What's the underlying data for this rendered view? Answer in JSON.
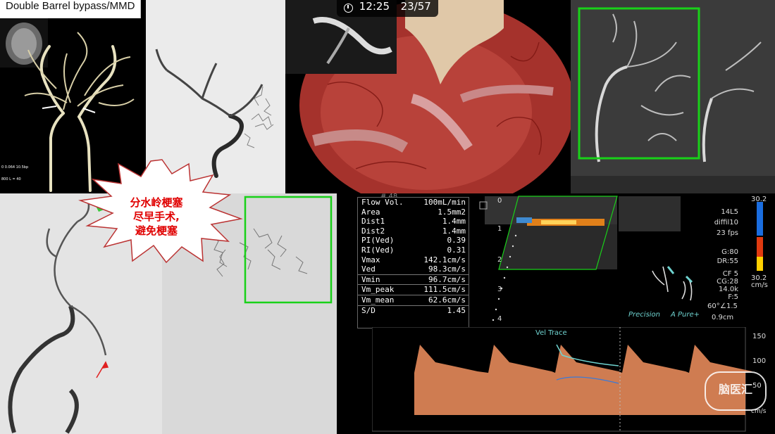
{
  "title": "Double Barrel bypass/MMD",
  "video": {
    "time": "12:25",
    "page": "23/57"
  },
  "callout": {
    "line1": "分水岭梗塞",
    "line2": "尽早手术,",
    "line3": "避免梗塞"
  },
  "mra_overlay": {
    "line1": "0 0.064 10.5bp",
    "line2": "800 L = 40"
  },
  "flow_measurements": [
    {
      "label": "Flow Vol.",
      "value": "100mL/min"
    },
    {
      "label": "Area",
      "value": "1.5mm2"
    },
    {
      "label": "Dist1",
      "value": "1.4mm"
    },
    {
      "label": "Dist2",
      "value": "1.4mm"
    },
    {
      "label": "PI(Ved)",
      "value": "0.39"
    },
    {
      "label": "RI(Ved)",
      "value": "0.31"
    },
    {
      "label": "Vmax",
      "value": "142.1cm/s"
    },
    {
      "label": "Ved",
      "value": "98.3cm/s"
    },
    {
      "label": "Vmin",
      "value": "96.7cm/s"
    },
    {
      "label": "Vm_peak",
      "value": "111.5cm/s"
    },
    {
      "label": "Vm_mean",
      "value": "62.6cm/s"
    },
    {
      "label": "S/D",
      "value": "1.45"
    }
  ],
  "ultrasound": {
    "frame_no": "# 48",
    "probe": "14L5",
    "mode": "diffil10",
    "fps": "23 fps",
    "gain": "G:80",
    "dr": "DR:55",
    "cf": "CF 5",
    "cg": "CG:28",
    "prf": "14.0k",
    "f": "F:5",
    "angle": "60°",
    "angle_corr": "∠1.5",
    "depth": "0.9cm",
    "scale_top": "30.2",
    "scale_bottom": "30.2",
    "scale_unit": "cm/s",
    "depth_ticks": [
      "0",
      "1",
      "2",
      "3",
      "4"
    ],
    "brand_precision": "Precision",
    "brand_apure": "A Pure+"
  },
  "doppler": {
    "trace_label": "Vel Trace",
    "scale_labels": [
      "150",
      "100",
      "50"
    ],
    "unit": "cm/s"
  },
  "watermark": {
    "text": "脑医汇"
  },
  "colors": {
    "callout_red": "#e00000",
    "box_green": "#19d119",
    "doppler_orange": "#e58a5a",
    "trace_teal": "#6fd3d0"
  }
}
